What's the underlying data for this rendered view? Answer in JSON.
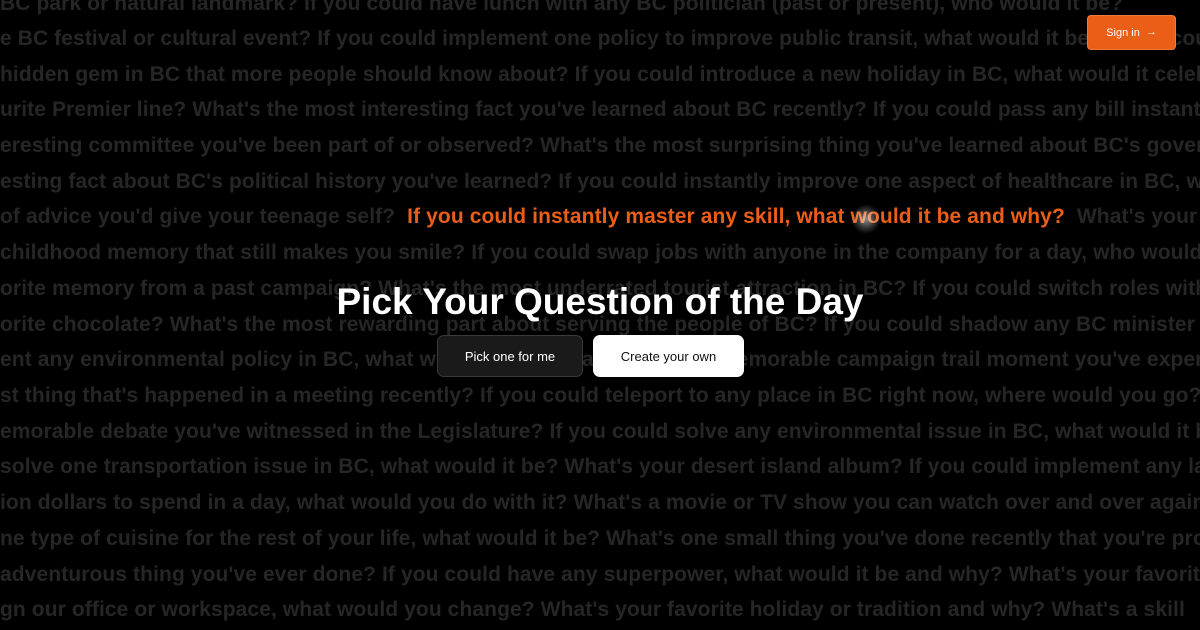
{
  "background_questions": [
    "BC park or natural landmark?  If you could have lunch with any BC politician (past or present), who would it be?",
    "e BC festival or cultural event?  If you could implement one policy to improve public transit, what would it be?  If you could",
    "hidden gem in BC that more people should know about?  If you could introduce a new holiday in BC, what would it celebrate?",
    "urite Premier line?  What's the most interesting fact you've learned about BC recently?  If you could pass any bill instantly",
    "eresting committee you've been part of or observed?  What's the most surprising thing you've learned about BC's government?",
    "esting fact about BC's political history you've learned?  If you could instantly improve one aspect of healthcare in BC, what",
    "of advice you'd give your teenage self?",
    "If you could instantly master any skill, what would it be and why?",
    "What's your",
    "childhood memory that still makes you smile?  If you could swap jobs with anyone in the company for a day, who would it be?",
    "orite memory from a past campaign?  What's the most underrated tourist attraction in BC?  If you could switch roles with",
    "orite chocolate?  What's the most rewarding part about serving the people of BC?  If you could shadow any BC minister",
    "ent any environmental policy in BC, what would it be?  What's the most memorable campaign trail moment you've experienced?",
    "st thing that's happened in a meeting recently?  If you could teleport to any place in BC right now, where would you go?",
    "emorable debate you've witnessed in the Legislature?  If you could solve any environmental issue in BC, what would it be?",
    " solve one transportation issue in BC, what would it be?  What's your desert island album?  If you could implement any law",
    "ion dollars to spend in a day, what would you do with it?  What's a movie or TV show you can watch over and over again?",
    "ne type of cuisine for the rest of your life, what would it be?  What's one small thing you've done recently that you're proud of?",
    "adventurous thing you've ever done?  If you could have any superpower, what would it be and why?  What's your favorite",
    "gn our office or workspace, what would you change?  What's your favorite holiday or tradition and why?  What's a skill"
  ],
  "highlighted_question": "If you could instantly master any skill, what would it be and why?",
  "title": "Pick Your Question of the Day",
  "buttons": {
    "pick_one": "Pick one for me",
    "create_own": "Create your own"
  },
  "header": {
    "signin_label": "Sign in",
    "signin_arrow": "→"
  },
  "colors": {
    "accent": "#ea5e18",
    "background": "#000000",
    "background_text": "#262626"
  }
}
